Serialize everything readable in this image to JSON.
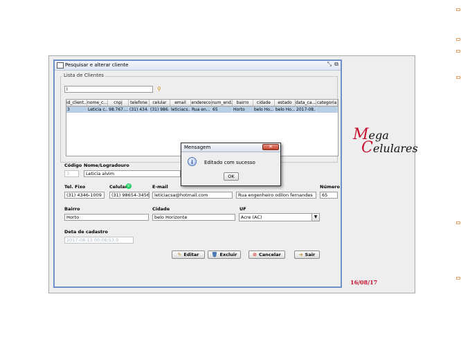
{
  "window": {
    "title": "Pesquisar e alterar cliente"
  },
  "list": {
    "group_label": "Lista de Clientes",
    "search_value": "l",
    "search_icon": "magnifier-icon",
    "columns": [
      "id_client...",
      "nome_c...",
      "cnpj",
      "telefone",
      "celular",
      "email",
      "endereco",
      "num_end...",
      "bairro",
      "cidade",
      "estado",
      "data_ca...",
      "categoria"
    ],
    "rows": [
      [
        "3",
        "Leticia c...",
        "98.767....",
        "(31) 434...",
        "(31) 986...",
        "leticiacs...",
        "Rua en...",
        "65",
        "Horto",
        "belo Ho...",
        "belo Ho...",
        "2017-08...",
        ""
      ]
    ]
  },
  "form": {
    "codigo_label": "Código",
    "codigo_value": "3",
    "nome_label": "Nome/Logradouro",
    "nome_value": "Leticia alvim",
    "tel_label": "Tel. Fixo",
    "tel_value": "(31) 4346-1009",
    "celular_label": "Celular",
    "celular_icon": "whatsapp-icon",
    "celular_value": "(31) 98654-3456",
    "email_label": "E-mail",
    "email_value": "leticiacsa@hotmail.com",
    "endereco_value": "Rua engenheiro odilon fernandes",
    "numero_label": "Número",
    "numero_value": "65",
    "bairro_label": "Bairro",
    "bairro_value": "Horto",
    "cidade_label": "Cidade",
    "cidade_value": "belo Horizonte",
    "uf_label": "UF",
    "uf_value": "Acre (AC)",
    "data_label": "Deta de cadastro",
    "data_value": "2017-08-13 00:06:53.0"
  },
  "buttons": {
    "editar": "Editar",
    "excluir": "Excluir",
    "cancelar": "Cancelar",
    "sair": "Sair"
  },
  "dialog": {
    "title": "Mensagem",
    "message": "Editado com sucesso",
    "ok": "OK",
    "icon": "info-icon"
  },
  "branding": {
    "logo_cap1": "M",
    "logo_rest1": "ega",
    "logo_cap2": "C",
    "logo_rest2": "elulares",
    "date": "16/08/17"
  },
  "colors": {
    "accent": "#c8102e",
    "selection": "#b8cfe5",
    "window_border": "#6e8fc8"
  }
}
